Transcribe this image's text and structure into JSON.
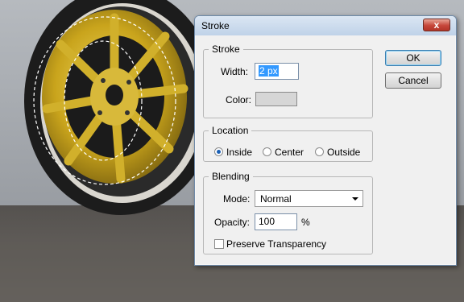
{
  "dialog": {
    "title": "Stroke",
    "close_label": "x",
    "ok_label": "OK",
    "cancel_label": "Cancel"
  },
  "stroke_group": {
    "legend": "Stroke",
    "width_label": "Width:",
    "width_value": "2 px",
    "color_label": "Color:",
    "color_value": "#d6d6d6"
  },
  "location_group": {
    "legend": "Location",
    "options": [
      "Inside",
      "Center",
      "Outside"
    ],
    "selected": "Inside"
  },
  "blending_group": {
    "legend": "Blending",
    "mode_label": "Mode:",
    "mode_value": "Normal",
    "opacity_label": "Opacity:",
    "opacity_value": "100",
    "opacity_unit": "%",
    "preserve_label": "Preserve Transparency",
    "preserve_checked": false
  },
  "background": {
    "description_icon": "car-wheel-image"
  }
}
